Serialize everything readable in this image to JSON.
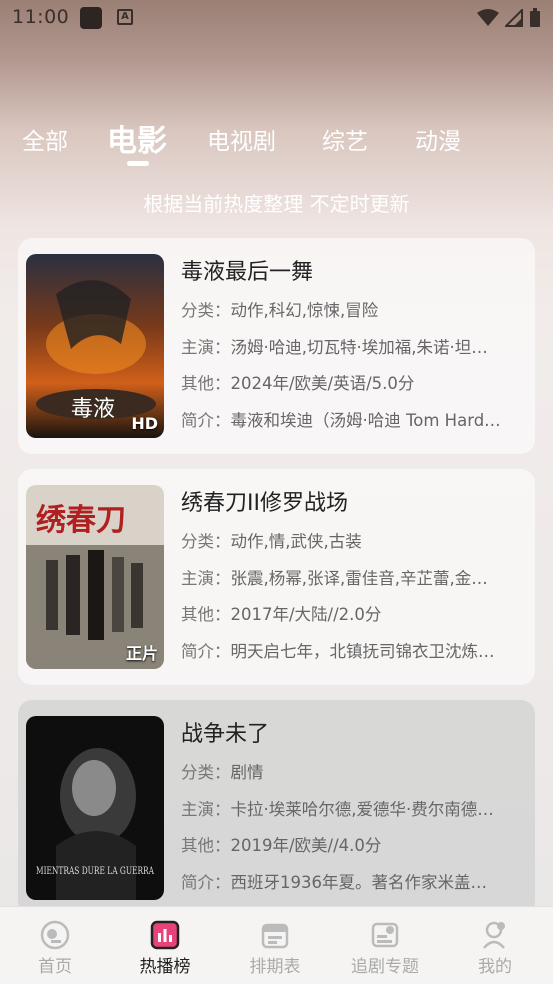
{
  "status_bar": {
    "time": "11:00",
    "a_icon": "A"
  },
  "tabs": [
    {
      "label": "全部"
    },
    {
      "label": "电影",
      "active": true
    },
    {
      "label": "电视剧"
    },
    {
      "label": "综艺"
    },
    {
      "label": "动漫"
    }
  ],
  "subtitle": "根据当前热度整理 不定时更新",
  "labels": {
    "category": "分类：",
    "cast": "主演：",
    "other": "其他：",
    "intro": "简介："
  },
  "movies": [
    {
      "title": "毒液最后一舞",
      "category": "动作,科幻,惊悚,冒险",
      "cast": "汤姆·哈迪,切瓦特·埃加福,朱诺·坦…",
      "other": "2024年/欧美/英语/5.0分",
      "intro": "毒液和埃迪（汤姆·哈迪 Tom Hard…",
      "badge": "HD",
      "poster_text": "毒液"
    },
    {
      "title": "绣春刀II修罗战场",
      "category": "动作,情,武侠,古装",
      "cast": "张震,杨幂,张译,雷佳音,辛芷蕾,金…",
      "other": "2017年/大陆//2.0分",
      "intro": "明天启七年，北镇抚司锦衣卫沈炼…",
      "badge": "正片",
      "poster_text": "绣春刀"
    },
    {
      "title": "战争未了",
      "category": "剧情",
      "cast": "卡拉·埃莱哈尔德,爱德华·费尔南德…",
      "other": "2019年/欧美//4.0分",
      "intro": "西班牙1936年夏。著名作家米盖…",
      "badge": "",
      "poster_text": "MIENTRAS DURE LA GUERRA"
    }
  ],
  "bottom_nav": [
    {
      "label": "首页",
      "icon": "home-icon"
    },
    {
      "label": "热播榜",
      "icon": "hot-chart-icon",
      "active": true
    },
    {
      "label": "排期表",
      "icon": "calendar-icon"
    },
    {
      "label": "追剧专题",
      "icon": "topic-icon"
    },
    {
      "label": "我的",
      "icon": "profile-icon"
    }
  ],
  "colors": {
    "accent": "#e8427a",
    "tab_text": "#ffffff",
    "nav_inactive": "#aaaaaa"
  }
}
